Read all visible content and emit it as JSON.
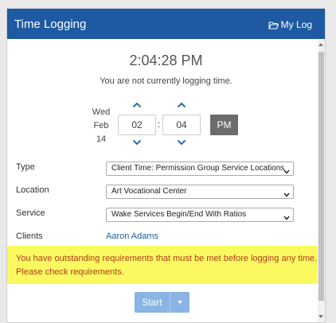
{
  "header": {
    "title": "Time Logging",
    "mylog_label": "My Log"
  },
  "clock": {
    "time": "2:04:28 PM",
    "status": "You are not currently logging time."
  },
  "date": {
    "weekday": "Wed",
    "month": "Feb",
    "day": "14"
  },
  "time_entry": {
    "hour": "02",
    "minute": "04",
    "separator": ":",
    "ampm": "PM"
  },
  "form": {
    "type_label": "Type",
    "type_value": "Client Time: Permission Group Service Locations",
    "location_label": "Location",
    "location_value": "Art Vocational Center",
    "service_label": "Service",
    "service_value": "Wake Services Begin/End With Ratios",
    "clients_label": "Clients",
    "client_name": "Aaron Adams"
  },
  "warning": {
    "line1": "You have outstanding requirements that must be met before logging any time.",
    "line2": "Please check requirements."
  },
  "actions": {
    "start_label": "Start"
  },
  "colors": {
    "header": "#1d5aa2",
    "warning_bg": "#fafa60",
    "warning_text": "#b23a1a",
    "start": "#8ab4e3"
  }
}
